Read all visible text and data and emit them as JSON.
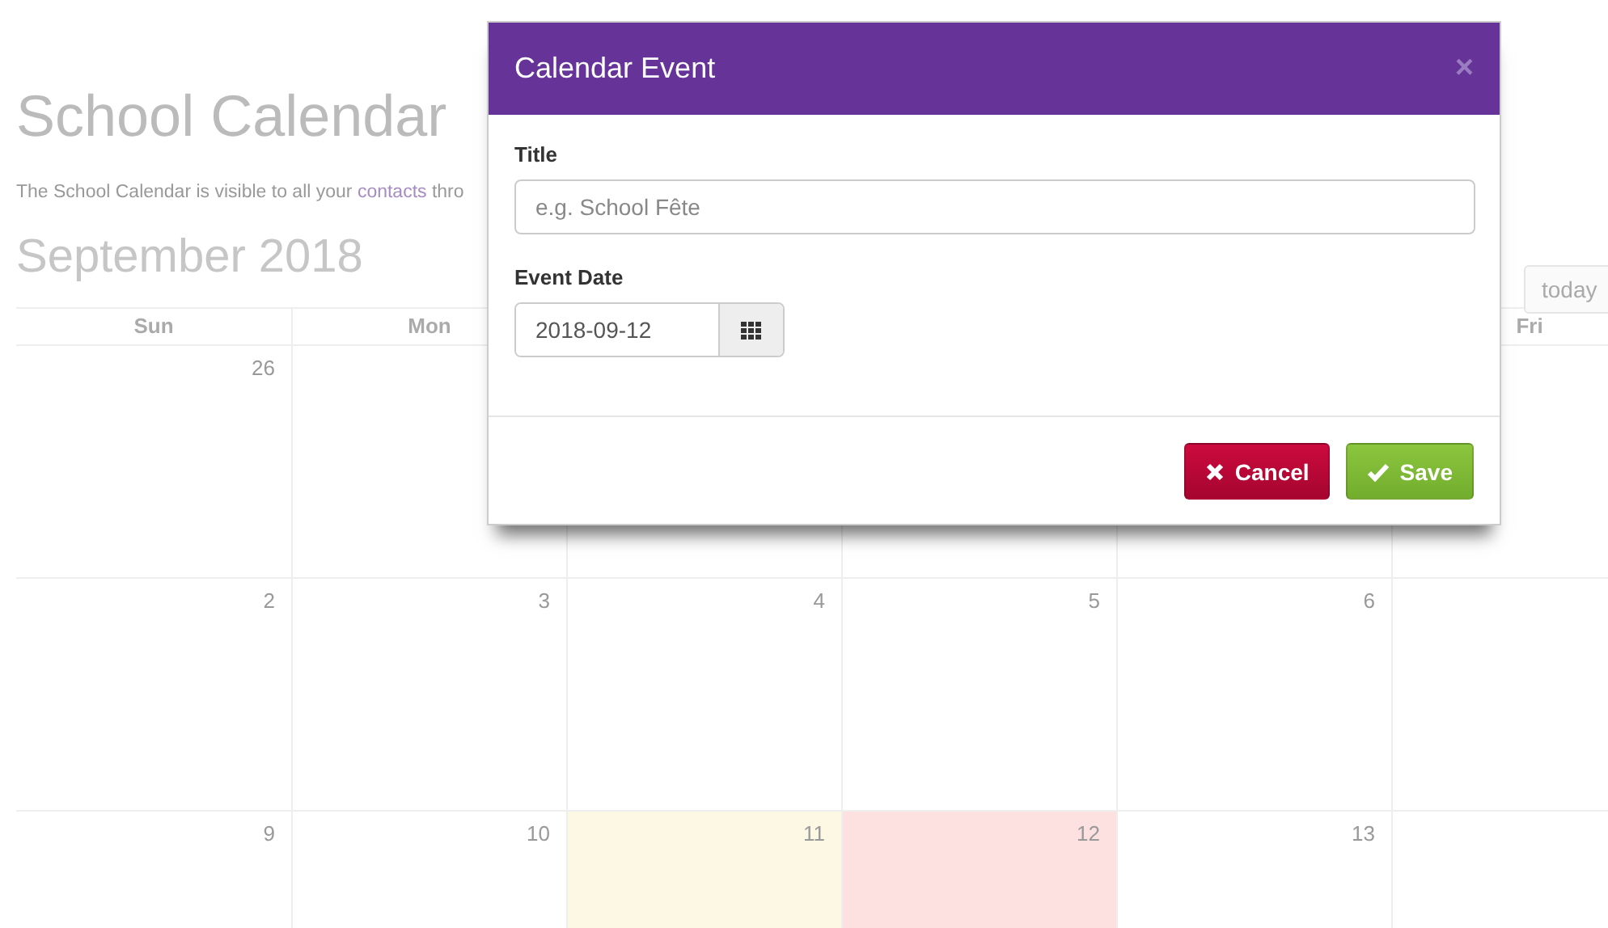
{
  "page": {
    "title": "School Calendar",
    "description": {
      "before": "The School Calendar is visible to all your ",
      "link": "contacts",
      "after": " thro"
    }
  },
  "calendar": {
    "month_title": "September 2018",
    "today_button": "today",
    "columns": [
      "Sun",
      "Mon",
      "",
      "",
      "",
      "Fri"
    ],
    "weeks": [
      {
        "days": [
          {
            "number": "26",
            "today": false,
            "selected": false
          }
        ]
      },
      {
        "days": [
          {
            "number": "2",
            "today": false,
            "selected": false
          },
          {
            "number": "3",
            "today": false,
            "selected": false
          },
          {
            "number": "4",
            "today": false,
            "selected": false
          },
          {
            "number": "5",
            "today": false,
            "selected": false
          },
          {
            "number": "6",
            "today": false,
            "selected": false
          }
        ]
      },
      {
        "days": [
          {
            "number": "9",
            "today": false,
            "selected": false
          },
          {
            "number": "10",
            "today": false,
            "selected": false
          },
          {
            "number": "11",
            "today": true,
            "selected": false
          },
          {
            "number": "12",
            "today": false,
            "selected": true
          },
          {
            "number": "13",
            "today": false,
            "selected": false
          }
        ]
      }
    ]
  },
  "dialog": {
    "title": "Calendar Event",
    "close": "×",
    "fields": [
      {
        "label": "Title",
        "placeholder": "e.g. School Fête"
      },
      {
        "label": "Event Date",
        "value": "2018-09-12"
      }
    ],
    "buttons": [
      {
        "kind": "cancel",
        "label": "Cancel"
      },
      {
        "kind": "save",
        "label": "Save"
      }
    ]
  }
}
